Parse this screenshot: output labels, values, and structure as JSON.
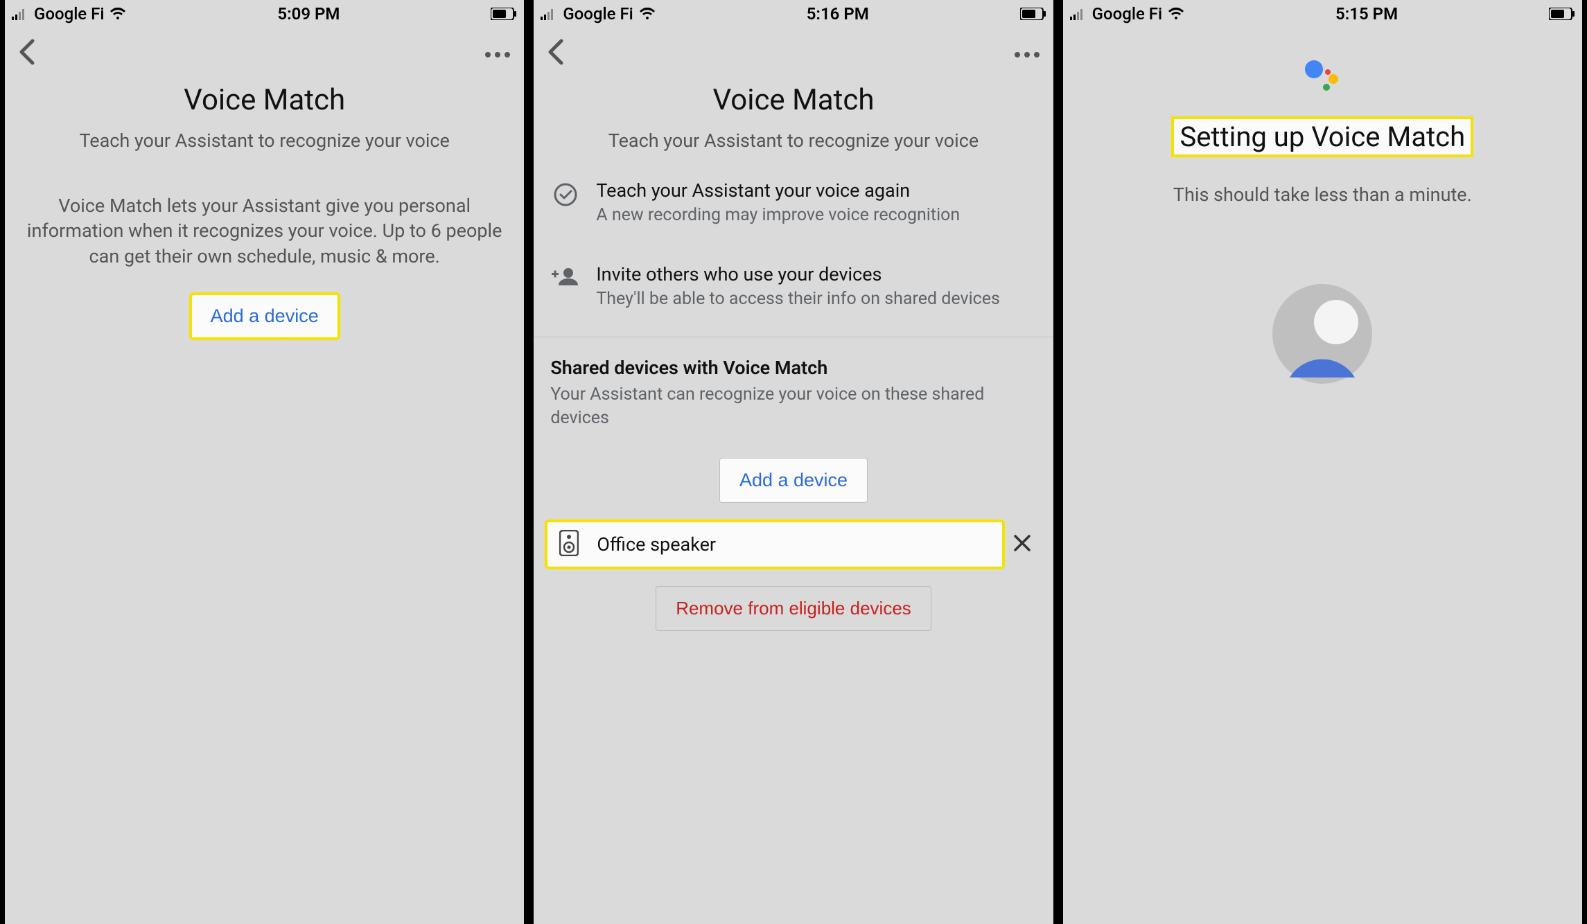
{
  "screen1": {
    "statusbar": {
      "carrier": "Google Fi",
      "time": "5:09 PM"
    },
    "title": "Voice Match",
    "subtitle": "Teach your Assistant to recognize your voice",
    "description": "Voice Match lets your Assistant give you personal information when it recognizes your voice. Up to 6 people can get their own schedule, music & more.",
    "add_device_label": "Add a device"
  },
  "screen2": {
    "statusbar": {
      "carrier": "Google Fi",
      "time": "5:16 PM"
    },
    "title": "Voice Match",
    "subtitle": "Teach your Assistant to recognize your voice",
    "options": [
      {
        "icon": "checkmark-circle-icon",
        "title": "Teach your Assistant your voice again",
        "sub": "A new recording may improve voice recognition"
      },
      {
        "icon": "person-add-icon",
        "title": "Invite others who use your devices",
        "sub": "They'll be able to access their info on shared devices"
      }
    ],
    "shared": {
      "header": "Shared devices with Voice Match",
      "desc": "Your Assistant can recognize your voice on these shared devices",
      "add_device_label": "Add a device",
      "device_name": "Office speaker",
      "remove_label": "Remove from eligible devices"
    }
  },
  "screen3": {
    "statusbar": {
      "carrier": "Google Fi",
      "time": "5:15 PM"
    },
    "title": "Setting up Voice Match",
    "subtitle": "This should take less than a minute."
  }
}
